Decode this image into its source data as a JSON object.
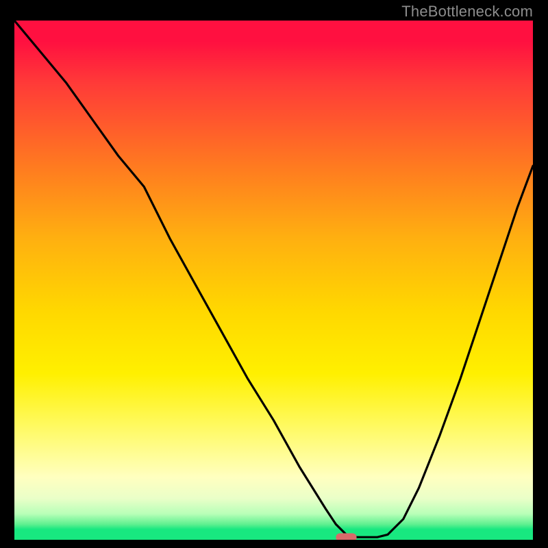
{
  "watermark": "TheBottleneck.com",
  "chart_data": {
    "type": "line",
    "title": "",
    "xlabel": "",
    "ylabel": "",
    "xlim": [
      0,
      100
    ],
    "ylim": [
      0,
      100
    ],
    "grid": false,
    "legend": false,
    "series": [
      {
        "name": "bottleneck-curve",
        "color": "#000000",
        "x": [
          0,
          5,
          10,
          15,
          20,
          25,
          30,
          35,
          40,
          45,
          50,
          55,
          60,
          62,
          64,
          66,
          68,
          70,
          72,
          75,
          78,
          82,
          86,
          90,
          94,
          97,
          100
        ],
        "y": [
          100,
          94,
          88,
          81,
          74,
          68,
          58,
          49,
          40,
          31,
          23,
          14,
          6,
          3,
          1,
          0.5,
          0.5,
          0.5,
          1,
          4,
          10,
          20,
          31,
          43,
          55,
          64,
          72
        ]
      }
    ],
    "marker": {
      "shape": "rounded-rect",
      "color": "#d86a6a",
      "x": 64,
      "y": 0.5,
      "width": 4,
      "height": 1.5
    },
    "background_gradient": {
      "stops": [
        {
          "pos": 0.0,
          "color": "#ff1040"
        },
        {
          "pos": 0.12,
          "color": "#ff3a38"
        },
        {
          "pos": 0.28,
          "color": "#ff7a20"
        },
        {
          "pos": 0.42,
          "color": "#ffb010"
        },
        {
          "pos": 0.56,
          "color": "#ffd800"
        },
        {
          "pos": 0.68,
          "color": "#fff000"
        },
        {
          "pos": 0.78,
          "color": "#fffa60"
        },
        {
          "pos": 0.88,
          "color": "#ffffc0"
        },
        {
          "pos": 0.95,
          "color": "#b8ffb8"
        },
        {
          "pos": 1.0,
          "color": "#18e880"
        }
      ]
    }
  }
}
